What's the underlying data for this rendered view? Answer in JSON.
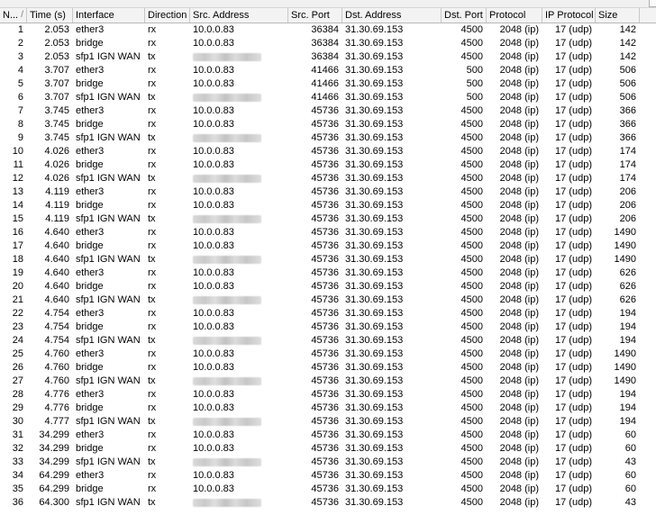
{
  "columns": [
    {
      "label": "N..."
    },
    {
      "label": "Time (s)"
    },
    {
      "label": "Interface"
    },
    {
      "label": "Direction"
    },
    {
      "label": "Src. Address"
    },
    {
      "label": "Src. Port"
    },
    {
      "label": "Dst. Address"
    },
    {
      "label": "Dst. Port"
    },
    {
      "label": "Protocol"
    },
    {
      "label": "IP Protocol"
    },
    {
      "label": "Size"
    }
  ],
  "sort_indicator": "/",
  "rows": [
    {
      "n": "1",
      "time": "2.053",
      "iface": "ether3",
      "dir": "rx",
      "src": "10.0.0.83",
      "sport": "36384",
      "dst": "31.30.69.153",
      "dport": "4500",
      "proto": "2048 (ip)",
      "ipproto": "17 (udp)",
      "size": "142"
    },
    {
      "n": "2",
      "time": "2.053",
      "iface": "bridge",
      "dir": "rx",
      "src": "10.0.0.83",
      "sport": "36384",
      "dst": "31.30.69.153",
      "dport": "4500",
      "proto": "2048 (ip)",
      "ipproto": "17 (udp)",
      "size": "142"
    },
    {
      "n": "3",
      "time": "2.053",
      "iface": "sfp1 IGN WAN",
      "dir": "tx",
      "src": "",
      "sport": "36384",
      "dst": "31.30.69.153",
      "dport": "4500",
      "proto": "2048 (ip)",
      "ipproto": "17 (udp)",
      "size": "142"
    },
    {
      "n": "4",
      "time": "3.707",
      "iface": "ether3",
      "dir": "rx",
      "src": "10.0.0.83",
      "sport": "41466",
      "dst": "31.30.69.153",
      "dport": "500",
      "proto": "2048 (ip)",
      "ipproto": "17 (udp)",
      "size": "506"
    },
    {
      "n": "5",
      "time": "3.707",
      "iface": "bridge",
      "dir": "rx",
      "src": "10.0.0.83",
      "sport": "41466",
      "dst": "31.30.69.153",
      "dport": "500",
      "proto": "2048 (ip)",
      "ipproto": "17 (udp)",
      "size": "506"
    },
    {
      "n": "6",
      "time": "3.707",
      "iface": "sfp1 IGN WAN",
      "dir": "tx",
      "src": "",
      "sport": "41466",
      "dst": "31.30.69.153",
      "dport": "500",
      "proto": "2048 (ip)",
      "ipproto": "17 (udp)",
      "size": "506"
    },
    {
      "n": "7",
      "time": "3.745",
      "iface": "ether3",
      "dir": "rx",
      "src": "10.0.0.83",
      "sport": "45736",
      "dst": "31.30.69.153",
      "dport": "4500",
      "proto": "2048 (ip)",
      "ipproto": "17 (udp)",
      "size": "366"
    },
    {
      "n": "8",
      "time": "3.745",
      "iface": "bridge",
      "dir": "rx",
      "src": "10.0.0.83",
      "sport": "45736",
      "dst": "31.30.69.153",
      "dport": "4500",
      "proto": "2048 (ip)",
      "ipproto": "17 (udp)",
      "size": "366"
    },
    {
      "n": "9",
      "time": "3.745",
      "iface": "sfp1 IGN WAN",
      "dir": "tx",
      "src": "",
      "sport": "45736",
      "dst": "31.30.69.153",
      "dport": "4500",
      "proto": "2048 (ip)",
      "ipproto": "17 (udp)",
      "size": "366"
    },
    {
      "n": "10",
      "time": "4.026",
      "iface": "ether3",
      "dir": "rx",
      "src": "10.0.0.83",
      "sport": "45736",
      "dst": "31.30.69.153",
      "dport": "4500",
      "proto": "2048 (ip)",
      "ipproto": "17 (udp)",
      "size": "174"
    },
    {
      "n": "11",
      "time": "4.026",
      "iface": "bridge",
      "dir": "rx",
      "src": "10.0.0.83",
      "sport": "45736",
      "dst": "31.30.69.153",
      "dport": "4500",
      "proto": "2048 (ip)",
      "ipproto": "17 (udp)",
      "size": "174"
    },
    {
      "n": "12",
      "time": "4.026",
      "iface": "sfp1 IGN WAN",
      "dir": "tx",
      "src": "",
      "sport": "45736",
      "dst": "31.30.69.153",
      "dport": "4500",
      "proto": "2048 (ip)",
      "ipproto": "17 (udp)",
      "size": "174"
    },
    {
      "n": "13",
      "time": "4.119",
      "iface": "ether3",
      "dir": "rx",
      "src": "10.0.0.83",
      "sport": "45736",
      "dst": "31.30.69.153",
      "dport": "4500",
      "proto": "2048 (ip)",
      "ipproto": "17 (udp)",
      "size": "206"
    },
    {
      "n": "14",
      "time": "4.119",
      "iface": "bridge",
      "dir": "rx",
      "src": "10.0.0.83",
      "sport": "45736",
      "dst": "31.30.69.153",
      "dport": "4500",
      "proto": "2048 (ip)",
      "ipproto": "17 (udp)",
      "size": "206"
    },
    {
      "n": "15",
      "time": "4.119",
      "iface": "sfp1 IGN WAN",
      "dir": "tx",
      "src": "",
      "sport": "45736",
      "dst": "31.30.69.153",
      "dport": "4500",
      "proto": "2048 (ip)",
      "ipproto": "17 (udp)",
      "size": "206"
    },
    {
      "n": "16",
      "time": "4.640",
      "iface": "ether3",
      "dir": "rx",
      "src": "10.0.0.83",
      "sport": "45736",
      "dst": "31.30.69.153",
      "dport": "4500",
      "proto": "2048 (ip)",
      "ipproto": "17 (udp)",
      "size": "1490"
    },
    {
      "n": "17",
      "time": "4.640",
      "iface": "bridge",
      "dir": "rx",
      "src": "10.0.0.83",
      "sport": "45736",
      "dst": "31.30.69.153",
      "dport": "4500",
      "proto": "2048 (ip)",
      "ipproto": "17 (udp)",
      "size": "1490"
    },
    {
      "n": "18",
      "time": "4.640",
      "iface": "sfp1 IGN WAN",
      "dir": "tx",
      "src": "",
      "sport": "45736",
      "dst": "31.30.69.153",
      "dport": "4500",
      "proto": "2048 (ip)",
      "ipproto": "17 (udp)",
      "size": "1490"
    },
    {
      "n": "19",
      "time": "4.640",
      "iface": "ether3",
      "dir": "rx",
      "src": "10.0.0.83",
      "sport": "45736",
      "dst": "31.30.69.153",
      "dport": "4500",
      "proto": "2048 (ip)",
      "ipproto": "17 (udp)",
      "size": "626"
    },
    {
      "n": "20",
      "time": "4.640",
      "iface": "bridge",
      "dir": "rx",
      "src": "10.0.0.83",
      "sport": "45736",
      "dst": "31.30.69.153",
      "dport": "4500",
      "proto": "2048 (ip)",
      "ipproto": "17 (udp)",
      "size": "626"
    },
    {
      "n": "21",
      "time": "4.640",
      "iface": "sfp1 IGN WAN",
      "dir": "tx",
      "src": "",
      "sport": "45736",
      "dst": "31.30.69.153",
      "dport": "4500",
      "proto": "2048 (ip)",
      "ipproto": "17 (udp)",
      "size": "626"
    },
    {
      "n": "22",
      "time": "4.754",
      "iface": "ether3",
      "dir": "rx",
      "src": "10.0.0.83",
      "sport": "45736",
      "dst": "31.30.69.153",
      "dport": "4500",
      "proto": "2048 (ip)",
      "ipproto": "17 (udp)",
      "size": "194"
    },
    {
      "n": "23",
      "time": "4.754",
      "iface": "bridge",
      "dir": "rx",
      "src": "10.0.0.83",
      "sport": "45736",
      "dst": "31.30.69.153",
      "dport": "4500",
      "proto": "2048 (ip)",
      "ipproto": "17 (udp)",
      "size": "194"
    },
    {
      "n": "24",
      "time": "4.754",
      "iface": "sfp1 IGN WAN",
      "dir": "tx",
      "src": "",
      "sport": "45736",
      "dst": "31.30.69.153",
      "dport": "4500",
      "proto": "2048 (ip)",
      "ipproto": "17 (udp)",
      "size": "194"
    },
    {
      "n": "25",
      "time": "4.760",
      "iface": "ether3",
      "dir": "rx",
      "src": "10.0.0.83",
      "sport": "45736",
      "dst": "31.30.69.153",
      "dport": "4500",
      "proto": "2048 (ip)",
      "ipproto": "17 (udp)",
      "size": "1490"
    },
    {
      "n": "26",
      "time": "4.760",
      "iface": "bridge",
      "dir": "rx",
      "src": "10.0.0.83",
      "sport": "45736",
      "dst": "31.30.69.153",
      "dport": "4500",
      "proto": "2048 (ip)",
      "ipproto": "17 (udp)",
      "size": "1490"
    },
    {
      "n": "27",
      "time": "4.760",
      "iface": "sfp1 IGN WAN",
      "dir": "tx",
      "src": "",
      "sport": "45736",
      "dst": "31.30.69.153",
      "dport": "4500",
      "proto": "2048 (ip)",
      "ipproto": "17 (udp)",
      "size": "1490"
    },
    {
      "n": "28",
      "time": "4.776",
      "iface": "ether3",
      "dir": "rx",
      "src": "10.0.0.83",
      "sport": "45736",
      "dst": "31.30.69.153",
      "dport": "4500",
      "proto": "2048 (ip)",
      "ipproto": "17 (udp)",
      "size": "194"
    },
    {
      "n": "29",
      "time": "4.776",
      "iface": "bridge",
      "dir": "rx",
      "src": "10.0.0.83",
      "sport": "45736",
      "dst": "31.30.69.153",
      "dport": "4500",
      "proto": "2048 (ip)",
      "ipproto": "17 (udp)",
      "size": "194"
    },
    {
      "n": "30",
      "time": "4.777",
      "iface": "sfp1 IGN WAN",
      "dir": "tx",
      "src": "",
      "sport": "45736",
      "dst": "31.30.69.153",
      "dport": "4500",
      "proto": "2048 (ip)",
      "ipproto": "17 (udp)",
      "size": "194"
    },
    {
      "n": "31",
      "time": "34.299",
      "iface": "ether3",
      "dir": "rx",
      "src": "10.0.0.83",
      "sport": "45736",
      "dst": "31.30.69.153",
      "dport": "4500",
      "proto": "2048 (ip)",
      "ipproto": "17 (udp)",
      "size": "60"
    },
    {
      "n": "32",
      "time": "34.299",
      "iface": "bridge",
      "dir": "rx",
      "src": "10.0.0.83",
      "sport": "45736",
      "dst": "31.30.69.153",
      "dport": "4500",
      "proto": "2048 (ip)",
      "ipproto": "17 (udp)",
      "size": "60"
    },
    {
      "n": "33",
      "time": "34.299",
      "iface": "sfp1 IGN WAN",
      "dir": "tx",
      "src": "",
      "sport": "45736",
      "dst": "31.30.69.153",
      "dport": "4500",
      "proto": "2048 (ip)",
      "ipproto": "17 (udp)",
      "size": "43"
    },
    {
      "n": "34",
      "time": "64.299",
      "iface": "ether3",
      "dir": "rx",
      "src": "10.0.0.83",
      "sport": "45736",
      "dst": "31.30.69.153",
      "dport": "4500",
      "proto": "2048 (ip)",
      "ipproto": "17 (udp)",
      "size": "60"
    },
    {
      "n": "35",
      "time": "64.299",
      "iface": "bridge",
      "dir": "rx",
      "src": "10.0.0.83",
      "sport": "45736",
      "dst": "31.30.69.153",
      "dport": "4500",
      "proto": "2048 (ip)",
      "ipproto": "17 (udp)",
      "size": "60"
    },
    {
      "n": "36",
      "time": "64.300",
      "iface": "sfp1 IGN WAN",
      "dir": "tx",
      "src": "",
      "sport": "45736",
      "dst": "31.30.69.153",
      "dport": "4500",
      "proto": "2048 (ip)",
      "ipproto": "17 (udp)",
      "size": "43"
    }
  ]
}
